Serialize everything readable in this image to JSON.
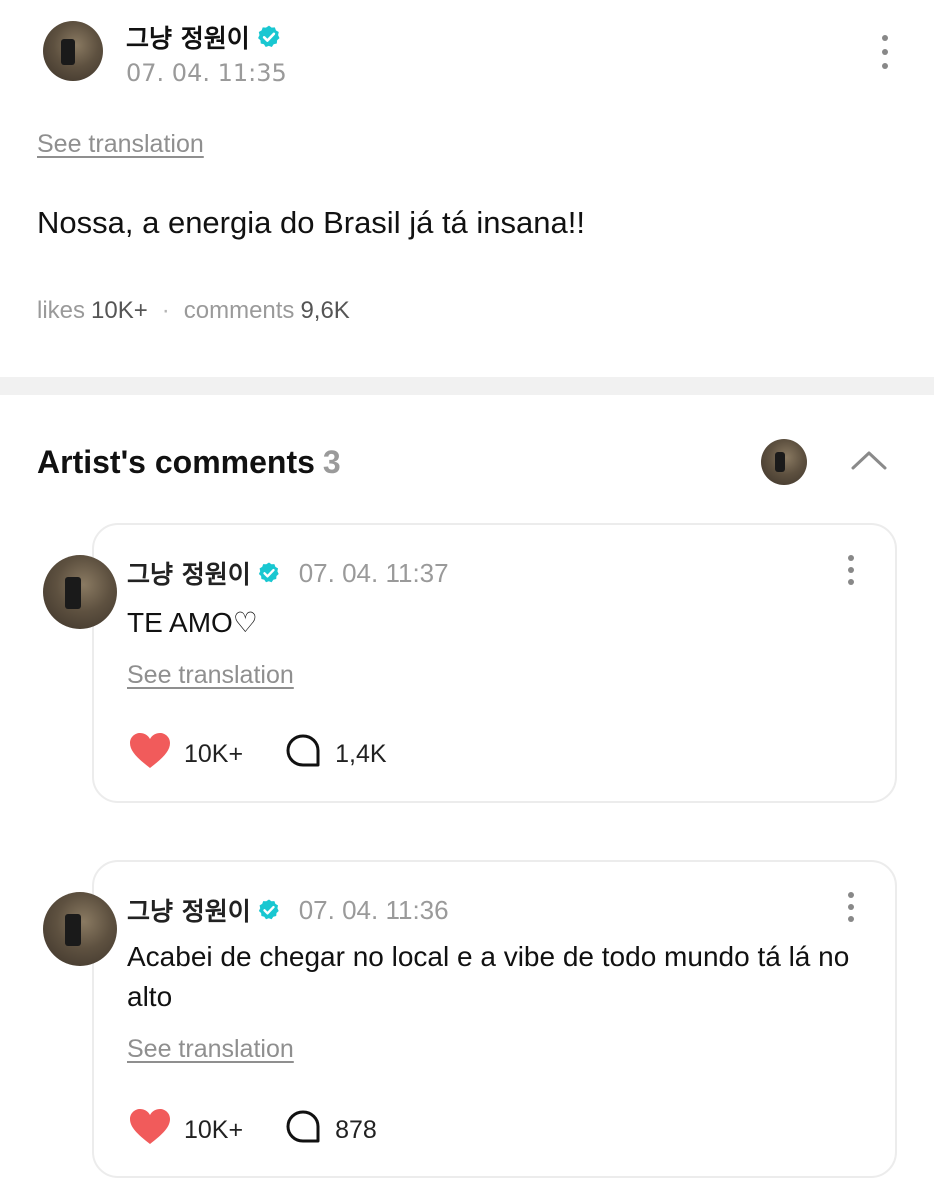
{
  "post": {
    "author": "그냥 정원이",
    "date": "07. 04. 11:35",
    "see_translation": "See translation",
    "body": "Nossa, a energia do Brasil já tá insana!!",
    "likes_label": "likes",
    "likes_value": "10K+",
    "comments_label": "comments",
    "comments_value": "9,6K"
  },
  "artist_comments": {
    "title": "Artist's comments",
    "count": "3",
    "items": [
      {
        "author": "그냥 정원이",
        "date": "07. 04. 11:37",
        "text": "TE AMO♡",
        "see_translation": "See translation",
        "likes": "10K+",
        "replies": "1,4K"
      },
      {
        "author": "그냥 정원이",
        "date": "07. 04. 11:36",
        "text": "Acabei de chegar no local e a vibe de todo mundo tá lá no alto",
        "see_translation": "See translation",
        "likes": "10K+",
        "replies": "878"
      }
    ]
  },
  "colors": {
    "verified": "#19c7d1",
    "heart": "#f15b5b",
    "muted_text": "#9a9a9a",
    "divider": "#f1f1f1"
  },
  "icons": {
    "verified": "verified-badge-icon",
    "more": "more-vertical-icon",
    "collapse": "chevron-up-icon",
    "like": "heart-icon",
    "reply": "speech-bubble-icon"
  }
}
